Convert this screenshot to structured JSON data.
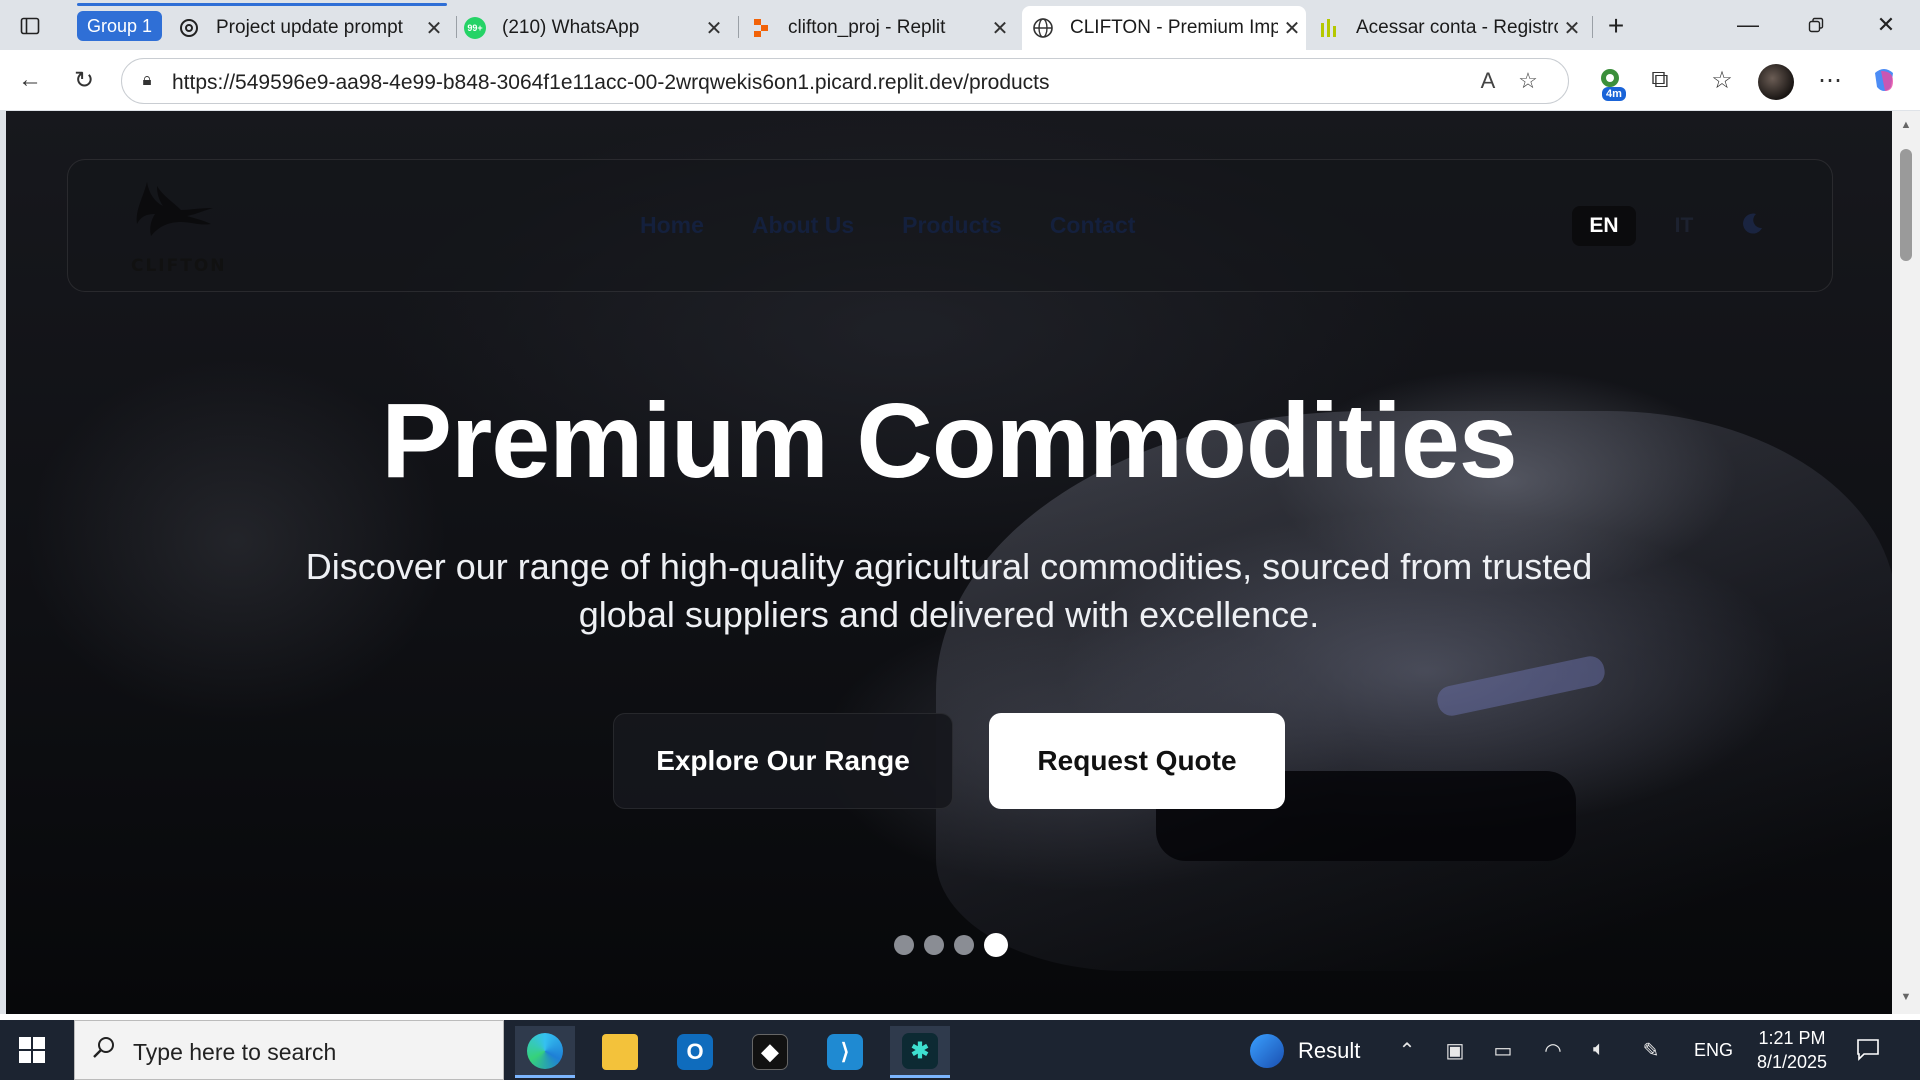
{
  "browser": {
    "group_label": "Group 1",
    "tabs": [
      {
        "title": "Project update prompt",
        "favicon": "openai-icon"
      },
      {
        "title": "(210) WhatsApp",
        "favicon": "whatsapp-icon",
        "favicon_badge": "99+"
      },
      {
        "title": "clifton_proj - Replit",
        "favicon": "replit-icon"
      },
      {
        "title": "CLIFTON - Premium Imp",
        "favicon": "globe-icon",
        "active": true
      },
      {
        "title": "Acessar conta - Registro",
        "favicon": "registro-icon"
      }
    ],
    "new_tab_icon": "plus-icon",
    "window_controls": [
      "minimize-icon",
      "restore-icon",
      "close-icon"
    ],
    "url": "https://549596e9-aa98-4e99-b848-3064f1e11acc-00-2wrqwekis6on1.picard.replit.dev/products",
    "extension_badge": "4m",
    "colors": {
      "accent": "#2f6fd6",
      "tabstrip_bg": "#dfe3e8"
    }
  },
  "site": {
    "logo_text": "Clifton",
    "nav": [
      {
        "label": "Home"
      },
      {
        "label": "About Us"
      },
      {
        "label": "Products"
      },
      {
        "label": "Contact"
      }
    ],
    "language_active": "EN",
    "language_other": "IT",
    "theme_toggle_icon": "moon-icon",
    "hero": {
      "title": "Premium Commodities",
      "subtitle": "Discover our range of high-quality agricultural commodities, sourced from trusted global suppliers and delivered with excellence.",
      "primary_button": "Explore Our Range",
      "secondary_button": "Request Quote",
      "slides_total": 4,
      "slide_active": 4
    },
    "colors": {
      "nav_text": "#14203d",
      "hero_text": "#ffffff"
    }
  },
  "taskbar": {
    "search_placeholder": "Type here to search",
    "apps": [
      "edge-icon",
      "file-explorer-icon",
      "outlook-icon",
      "app-cube-icon",
      "vscode-icon",
      "app-active-icon"
    ],
    "weather_label": "Result",
    "language": "ENG",
    "time": "1:21 PM",
    "date": "8/1/2025"
  }
}
